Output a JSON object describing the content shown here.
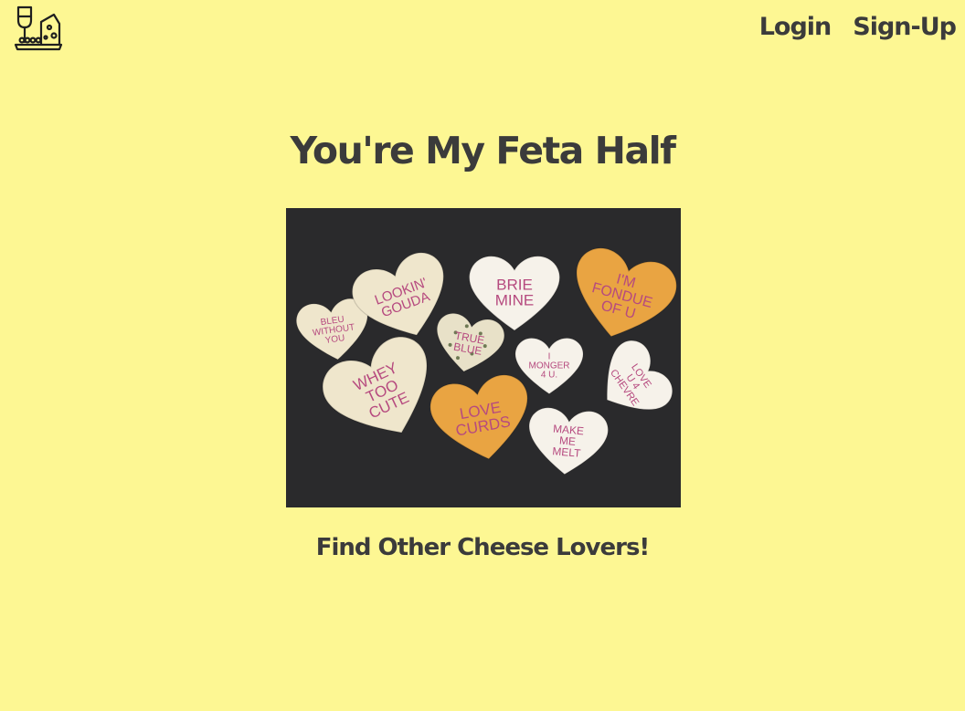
{
  "header": {
    "logo_icon": "wine-and-cheese-icon",
    "nav": {
      "login_label": "Login",
      "signup_label": "Sign-Up"
    }
  },
  "main": {
    "title": "You're My Feta Half",
    "image": {
      "hearts": [
        {
          "text": "BLEU WITHOUT YOU"
        },
        {
          "text": "LOOKIN' GOUDA"
        },
        {
          "text": "BRIE MINE"
        },
        {
          "text": "I'M FONDUE OF U"
        },
        {
          "text": "TRUE BLUE"
        },
        {
          "text": "I MONGER 4 U"
        },
        {
          "text": "LOVE U 4 CHEVRE"
        },
        {
          "text": "WHEY TOO CUTE"
        },
        {
          "text": "LOVE CURDS"
        },
        {
          "text": "MAKE ME MELT"
        }
      ]
    },
    "cta_label": "Find Other Cheese Lovers!"
  },
  "colors": {
    "background": "#fdf793",
    "text": "#3b3b3b",
    "slate": "#2a2a2c",
    "cream_cheese": "#f3ecd6",
    "orange_cheese": "#e9a442",
    "heart_text": "#b64a7f"
  }
}
